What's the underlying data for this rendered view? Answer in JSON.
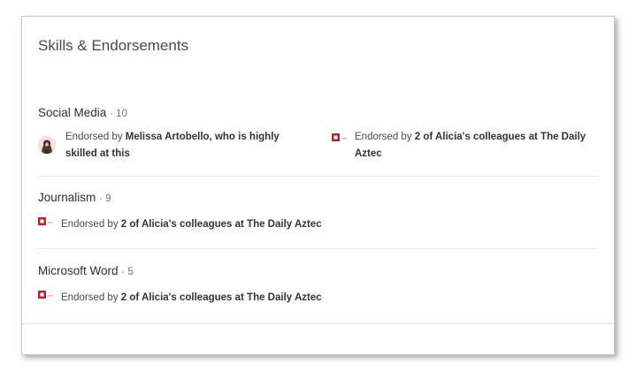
{
  "section": {
    "title": "Skills & Endorsements"
  },
  "skills": [
    {
      "name": "Social Media",
      "count": "10",
      "endorsements": [
        {
          "icon": "person-avatar",
          "prefix": "Endorsed by ",
          "highlight": "Melissa Artobello, who is highly skilled at this",
          "suffix": ""
        },
        {
          "icon": "company-logo-icon",
          "prefix": "Endorsed by ",
          "highlight": "2 of Alicia's colleagues at The Daily Aztec",
          "suffix": ""
        }
      ]
    },
    {
      "name": "Journalism",
      "count": "9",
      "endorsements": [
        {
          "icon": "company-logo-icon",
          "prefix": "Endorsed by ",
          "highlight": "2 of Alicia's colleagues at The Daily Aztec",
          "suffix": ""
        }
      ]
    },
    {
      "name": "Microsoft Word",
      "count": "5",
      "endorsements": [
        {
          "icon": "company-logo-icon",
          "prefix": "Endorsed by ",
          "highlight": "2 of Alicia's colleagues at The Daily Aztec",
          "suffix": ""
        }
      ]
    }
  ],
  "separator": "·",
  "colors": {
    "logo_red": "#c0202a",
    "divider": "#e6e6e6",
    "text": "#333333"
  }
}
